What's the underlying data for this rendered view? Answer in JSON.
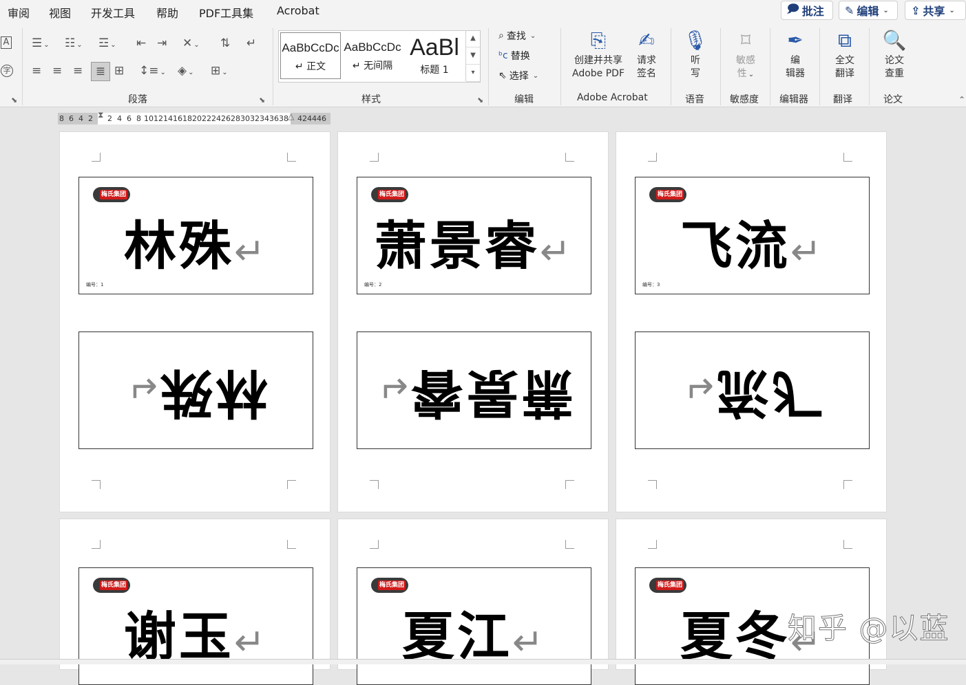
{
  "menu": {
    "items": [
      "审阅",
      "视图",
      "开发工具",
      "帮助",
      "PDF工具集",
      "Acrobat"
    ],
    "comment_btn": "批注",
    "edit_btn": "编辑",
    "share_btn": "共享"
  },
  "ribbon": {
    "groups": {
      "paragraph": "段落",
      "styles": "样式",
      "editing": "编辑",
      "acrobat": "Adobe Acrobat",
      "voice": "语音",
      "sensitivity": "敏感度",
      "editor": "编辑器",
      "translate": "翻译",
      "paper": "论文"
    },
    "styles": [
      {
        "sample": "AaBbCcDc",
        "name": "↵ 正文"
      },
      {
        "sample": "AaBbCcDc",
        "name": "↵ 无间隔"
      },
      {
        "sample": "AaBl",
        "name": "标题 1"
      }
    ],
    "find": "查找",
    "replace": "替换",
    "select": "选择",
    "create_share": "创建并共享",
    "adobe_pdf": "Adobe PDF",
    "request": "请求",
    "sign": "签名",
    "listen1": "听",
    "listen2": "写",
    "sens1": "敏感",
    "sens2": "性",
    "editor1": "编",
    "editor2": "辑器",
    "trans1": "全文",
    "trans2": "翻译",
    "paper1": "论文",
    "paper2": "查重"
  },
  "ruler": {
    "left": [
      "8",
      "6",
      "4",
      "2"
    ],
    "right": [
      "2",
      "4",
      "6",
      "8",
      "10",
      "12",
      "14",
      "16",
      "18",
      "20",
      "22",
      "24",
      "26",
      "28",
      "30",
      "32",
      "34",
      "36",
      "38"
    ],
    "tail": [
      "42",
      "44",
      "46"
    ]
  },
  "cards": [
    {
      "name": "林殊",
      "number": "编号：1"
    },
    {
      "name": "萧景睿",
      "number": "编号：2"
    },
    {
      "name": "飞流",
      "number": "编号：3"
    },
    {
      "name": "谢玉"
    },
    {
      "name": "夏江"
    },
    {
      "name": "夏冬"
    }
  ],
  "logo_text": "梅氏集团",
  "return_mark": "↵",
  "watermark": "知乎 @以蓝"
}
